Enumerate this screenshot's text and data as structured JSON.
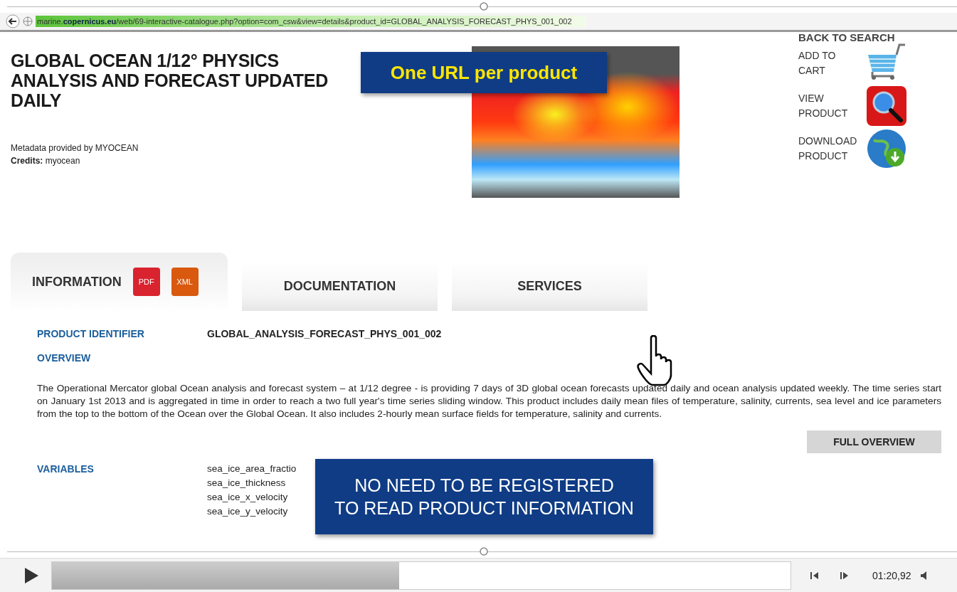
{
  "browser": {
    "url": "marine.**copernicus.eu**/web/69-interactive-catalogue.php?option=com_csw&view=details&product_id=GLOBAL_ANALYSIS_FORECAST_PHYS_001_002"
  },
  "page": {
    "title": "GLOBAL OCEAN 1/12° PHYSICS ANALYSIS AND FORECAST UPDATED DAILY",
    "metadata": "Metadata provided by MYOCEAN",
    "credits": "**Credits:** myocean",
    "back_to_search": "BACK TO SEARCH",
    "actions": [
      {
        "label": "ADD TO\nCART",
        "kind": "cart"
      },
      {
        "label": "VIEW\nPRODUCT",
        "kind": "view"
      },
      {
        "label": "DOWNLOAD\nPRODUCT",
        "kind": "download"
      }
    ],
    "tabs": [
      {
        "label": "INFORMATION",
        "selected": true
      },
      {
        "label": "DOCUMENTATION",
        "selected": false
      },
      {
        "label": "SERVICES",
        "selected": false
      }
    ],
    "file_badges": [
      {
        "label": "PDF",
        "color": "#d9232e"
      },
      {
        "label": "XML",
        "color": "#d9590f"
      }
    ],
    "product_identifier": {
      "label": "PRODUCT IDENTIFIER",
      "value": "GLOBAL_ANALYSIS_FORECAST_PHYS_001_002"
    },
    "overview": {
      "label": "OVERVIEW",
      "text": "The Operational Mercator global Ocean analysis and forecast system – at 1/12 degree - is providing 7 days of 3D global ocean forecasts updated daily and ocean analysis updated weekly. The time series start on January 1st 2013 and is aggregated in time in order to reach a two full year's time series sliding window. This product includes daily mean files of temperature, salinity, currents, sea level and ice parameters from the top to the bottom of the Ocean over the Global Ocean. It also includes 2-hourly mean surface fields for temperature, salinity and currents."
    },
    "full_overview_button": "FULL OVERVIEW",
    "variables": {
      "label": "VARIABLES",
      "items": [
        "sea_ice_area_fractio",
        "sea_ice_thickness",
        "sea_ice_x_velocity",
        "sea_ice_y_velocity"
      ]
    }
  },
  "captions": [
    "One URL per product",
    "NO NEED TO BE REGISTERED\nTO READ PRODUCT INFORMATION"
  ],
  "player": {
    "level": 0.47,
    "time": "01:20,92"
  }
}
